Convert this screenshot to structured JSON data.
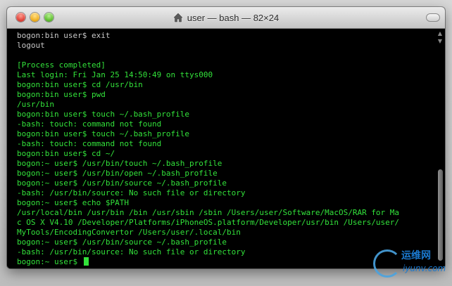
{
  "window": {
    "title": "user — bash — 82×24"
  },
  "terminal": {
    "lines": [
      {
        "text": "bogon:bin user$ exit",
        "color": "gray"
      },
      {
        "text": "logout",
        "color": "gray"
      },
      {
        "text": "",
        "color": "blank"
      },
      {
        "text": "[Process completed]",
        "color": "green"
      },
      {
        "text": "Last login: Fri Jan 25 14:50:49 on ttys000",
        "color": "green"
      },
      {
        "text": "bogon:bin user$ cd /usr/bin",
        "color": "green"
      },
      {
        "text": "bogon:bin user$ pwd",
        "color": "green"
      },
      {
        "text": "/usr/bin",
        "color": "green"
      },
      {
        "text": "bogon:bin user$ touch ~/.bash_profile",
        "color": "green"
      },
      {
        "text": "-bash: touch: command not found",
        "color": "green"
      },
      {
        "text": "bogon:bin user$ touch ~/.bash_profile",
        "color": "green"
      },
      {
        "text": "-bash: touch: command not found",
        "color": "green"
      },
      {
        "text": "bogon:bin user$ cd ~/",
        "color": "green"
      },
      {
        "text": "bogon:~ user$ /usr/bin/touch ~/.bash_profile",
        "color": "green"
      },
      {
        "text": "bogon:~ user$ /usr/bin/open ~/.bash_profile",
        "color": "green"
      },
      {
        "text": "bogon:~ user$ /usr/bin/source ~/.bash_profile",
        "color": "green"
      },
      {
        "text": "-bash: /usr/bin/source: No such file or directory",
        "color": "green"
      },
      {
        "text": "bogon:~ user$ echo $PATH",
        "color": "green"
      },
      {
        "text": "/usr/local/bin /usr/bin /bin /usr/sbin /sbin /Users/user/Software/MacOS/RAR for Ma",
        "color": "green"
      },
      {
        "text": "c OS X V4.10 /Developer/Platforms/iPhoneOS.platform/Developer/usr/bin /Users/user/",
        "color": "green"
      },
      {
        "text": "MyTools/EncodingConvertor /Users/user/.local/bin",
        "color": "green"
      },
      {
        "text": "bogon:~ user$ /usr/bin/source ~/.bash_profile",
        "color": "green"
      },
      {
        "text": "-bash: /usr/bin/source: No such file or directory",
        "color": "green"
      },
      {
        "text": "bogon:~ user$ ",
        "color": "green",
        "cursor": true
      }
    ]
  },
  "watermark": {
    "cn": "运维网",
    "en": "iyunv.com"
  }
}
